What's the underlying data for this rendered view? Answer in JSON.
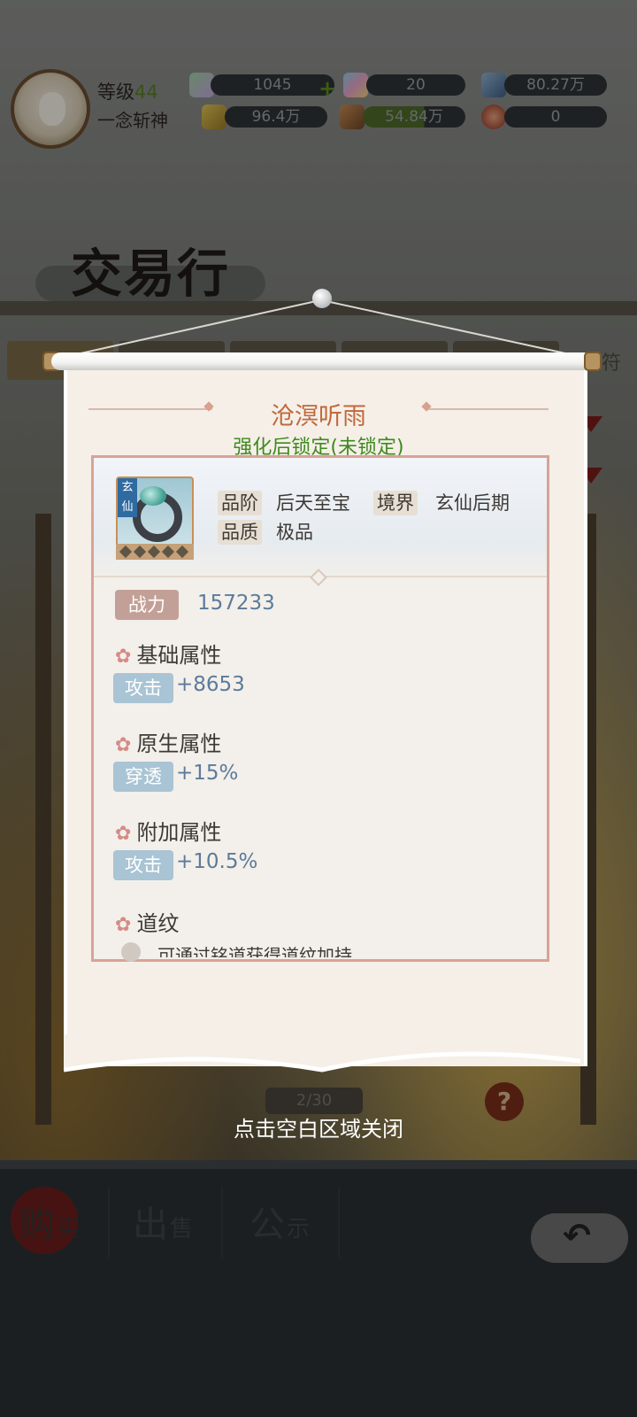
{
  "player": {
    "level_label": "等级",
    "level_value": "44",
    "name": "一念斩神"
  },
  "resources": [
    {
      "icon": "spirit-stone-icon",
      "value": "1045",
      "has_plus": true
    },
    {
      "icon": "rainbow-crystal-icon",
      "value": "20"
    },
    {
      "icon": "blue-gem-icon",
      "value": "80.27万"
    },
    {
      "icon": "gold-ingot-icon",
      "value": "96.4万"
    },
    {
      "icon": "ore-icon",
      "value": "54.84万"
    },
    {
      "icon": "red-token-icon",
      "value": "0"
    }
  ],
  "screen_title": "交易行",
  "background": {
    "partial_tab_text": "符",
    "pager_text": "2/30",
    "help_label": "?"
  },
  "item": {
    "name": "沧溟听雨",
    "lock_status": "强化后锁定(未锁定)",
    "realm_badge": "玄仙",
    "grade_label": "品阶",
    "grade_value": "后天至宝",
    "realm_label": "境界",
    "realm_value": "玄仙后期",
    "quality_label": "品质",
    "quality_value": "极品",
    "power_label": "战力",
    "power_value": "157233",
    "sections": {
      "base_title": "基础属性",
      "base_stat_label": "攻击",
      "base_stat_value": "+8653",
      "native_title": "原生属性",
      "native_stat_label": "穿透",
      "native_stat_value": "+15%",
      "extra_title": "附加属性",
      "extra_stat_label": "攻击",
      "extra_stat_value": "+10.5%",
      "dao_title": "道纹",
      "dao_text": "可通过铭道获得道纹加持"
    }
  },
  "close_hint": "点击空白区域关闭",
  "bottom_nav": {
    "buy_main": "购",
    "buy_sub": "买",
    "sell_main": "出",
    "sell_sub": "售",
    "notice_main": "公",
    "notice_sub": "示"
  },
  "colors": {
    "item_name": "#c0693c",
    "lock_status": "#3e8a1e",
    "stat_value": "#5b7b9a",
    "stat_pill": "#a9c4d4",
    "power_pill": "#c3a097"
  }
}
